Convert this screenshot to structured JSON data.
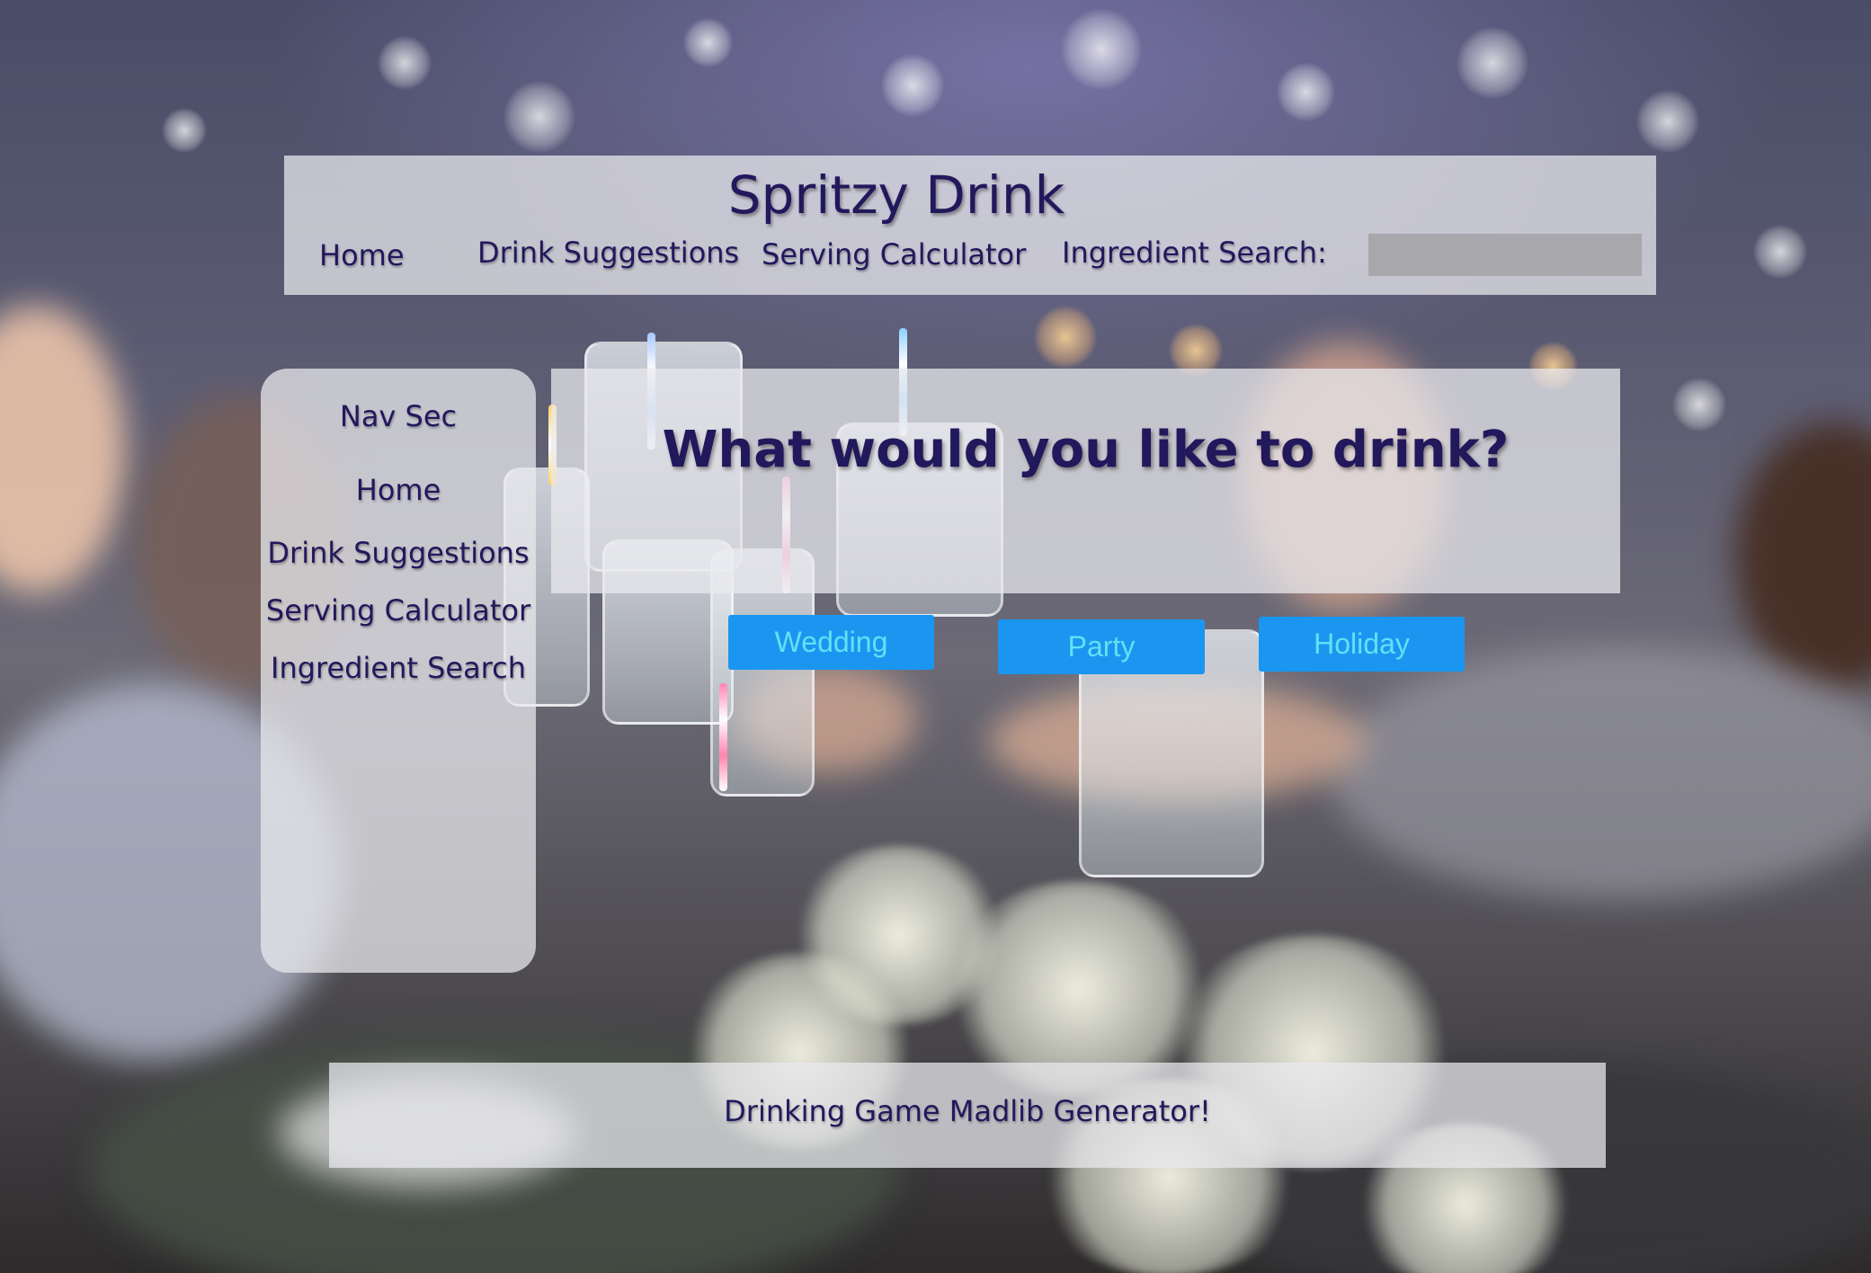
{
  "header": {
    "title": "Spritzy Drink",
    "nav": [
      "Home",
      "Drink Suggestions",
      "Serving Calculator"
    ],
    "search_label": "Ingredient Search:",
    "search_value": ""
  },
  "sidebar": {
    "heading": "Nav Sec",
    "items": [
      "Home",
      "Drink Suggestions",
      "Serving Calculator",
      "Ingredient Search"
    ]
  },
  "hero": {
    "question": "What would you like to drink?",
    "buttons": [
      "Wedding",
      "Party",
      "Holiday"
    ]
  },
  "footer": {
    "link": "Drinking Game Madlib Generator!"
  },
  "colors": {
    "text": "#22185c",
    "button_bg": "#1a96f0",
    "button_text": "#63e0f5",
    "panel": "rgba(233,233,238,0.74)",
    "search_bg": "#a8a8ac"
  },
  "background": {
    "description_icon": "party-toast-photo"
  }
}
